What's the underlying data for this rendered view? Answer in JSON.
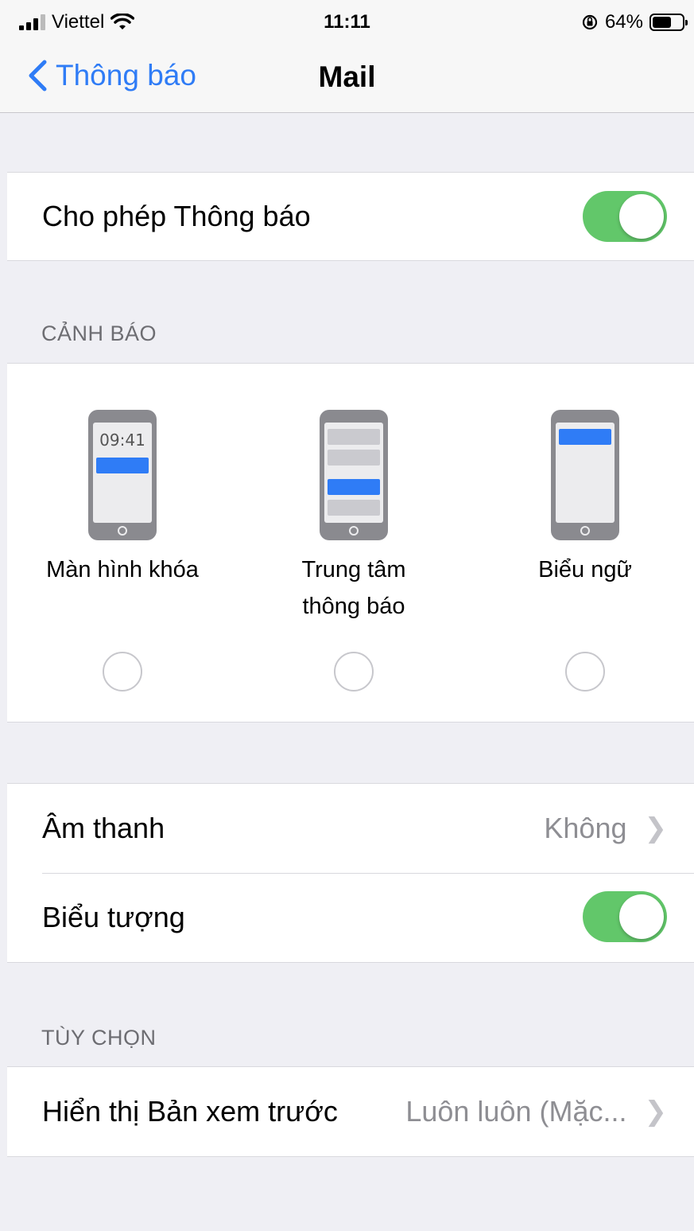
{
  "status_bar": {
    "carrier": "Viettel",
    "time": "11:11",
    "battery": "64%"
  },
  "nav": {
    "back_label": "Thông báo",
    "title": "Mail"
  },
  "allow_notifications": {
    "label": "Cho phép Thông báo",
    "enabled": true
  },
  "alerts": {
    "header": "CẢNH BÁO",
    "options": [
      {
        "label": "Màn hình khóa",
        "preview_time": "09:41",
        "selected": false
      },
      {
        "label": "Trung tâm thông báo",
        "selected": false
      },
      {
        "label": "Biểu ngữ",
        "selected": false
      }
    ]
  },
  "sound": {
    "label": "Âm thanh",
    "value": "Không"
  },
  "badges": {
    "label": "Biểu tượng",
    "enabled": true
  },
  "options": {
    "header": "TÙY CHỌN",
    "show_previews": {
      "label": "Hiển thị Bản xem trước",
      "value": "Luôn luôn (Mặc..."
    }
  },
  "colors": {
    "accent": "#2f7cf6",
    "toggle_on": "#62c76a",
    "background": "#efeff4"
  }
}
